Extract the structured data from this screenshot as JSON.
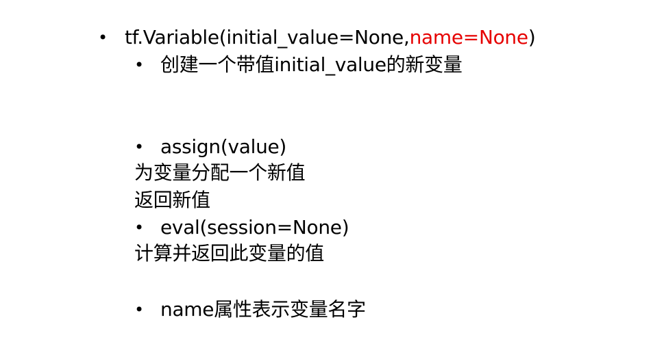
{
  "bullet_glyph": "•",
  "items": [
    {
      "level": 1,
      "text_main": "tf.Variable(initial_value=None,",
      "text_highlight": "name=None",
      "text_tail": ")",
      "highlight_color": "#e60000"
    },
    {
      "level": 2,
      "text": "创建一个带值initial_value的新变量"
    },
    {
      "level": 2,
      "text": "assign(value)",
      "paragraphs": [
        "为变量分配一个新值",
        "返回新值"
      ]
    },
    {
      "level": 2,
      "text": "eval(session=None)",
      "paragraphs": [
        "计算并返回此变量的值"
      ]
    },
    {
      "level": 2,
      "text": "name属性表示变量名字"
    }
  ]
}
